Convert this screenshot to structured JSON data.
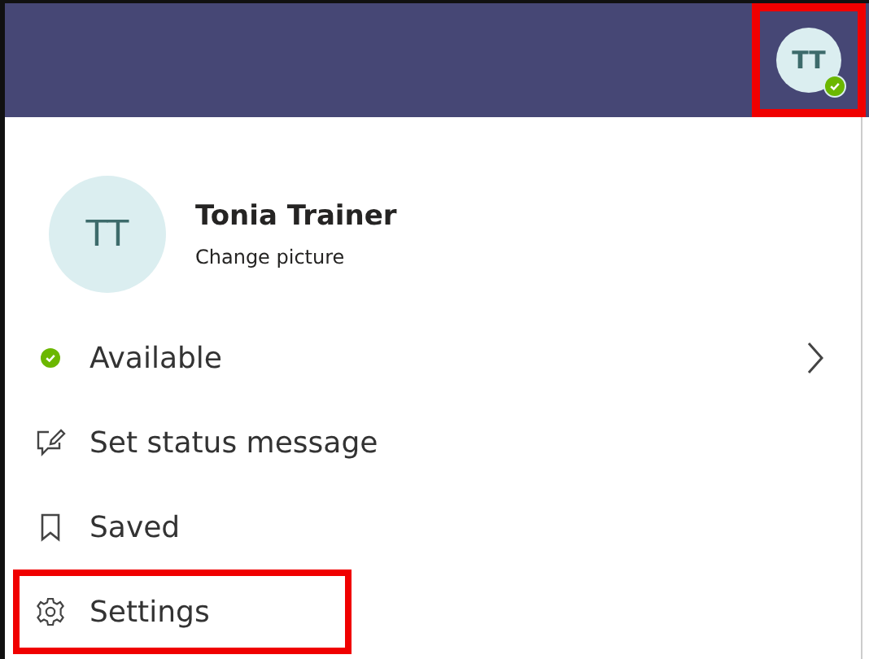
{
  "header": {
    "avatar": {
      "initials": "TT",
      "highlighted": true
    }
  },
  "profile": {
    "initials": "TT",
    "name": "Tonia Trainer",
    "action": "Change picture"
  },
  "menu": [
    {
      "kind": "status",
      "label": "Available",
      "color": "#6bb700",
      "submenu": true,
      "highlighted": false
    },
    {
      "kind": "message",
      "label": "Set status message",
      "submenu": false,
      "highlighted": false
    },
    {
      "kind": "saved",
      "label": "Saved",
      "submenu": false,
      "highlighted": false
    },
    {
      "kind": "settings",
      "label": "Settings",
      "submenu": false,
      "highlighted": true
    }
  ]
}
